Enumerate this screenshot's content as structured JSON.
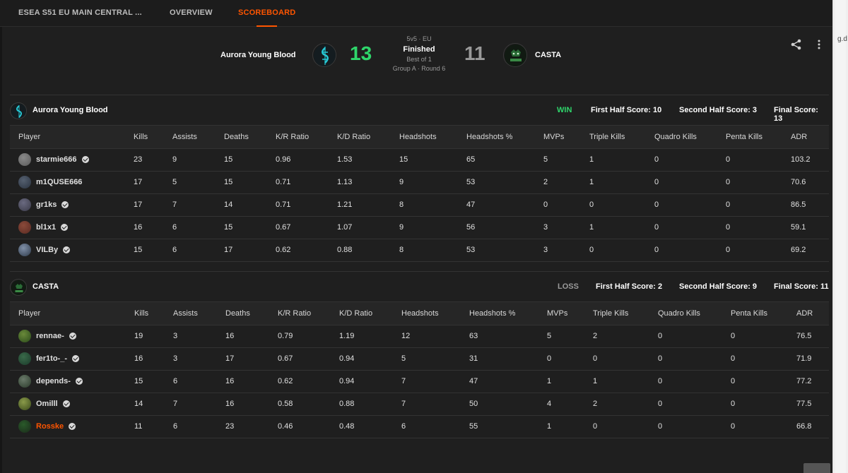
{
  "nav": {
    "tabs": [
      {
        "label": "ESEA S51 EU MAIN CENTRAL ..."
      },
      {
        "label": "OVERVIEW"
      },
      {
        "label": "SCOREBOARD",
        "active": true
      }
    ]
  },
  "edge_text": "g.d",
  "match": {
    "team_a": {
      "name": "Aurora Young Blood",
      "score": "13"
    },
    "team_b": {
      "name": "CASTA",
      "score": "11"
    },
    "format": "5v5 · EU",
    "status": "Finished",
    "best_of": "Best of 1",
    "stage": "Group A · Round 6"
  },
  "colors": {
    "accent": "#ff5500",
    "win": "#2fd66b",
    "loss": "#9a9a9a"
  },
  "icons": {
    "share": "share-icon",
    "more": "more-vertical-icon",
    "verified": "verified-badge-icon"
  },
  "columns": [
    "Player",
    "Kills",
    "Assists",
    "Deaths",
    "K/R Ratio",
    "K/D Ratio",
    "Headshots",
    "Headshots %",
    "MVPs",
    "Triple Kills",
    "Quadro Kills",
    "Penta Kills",
    "ADR"
  ],
  "teams": [
    {
      "name": "Aurora Young Blood",
      "result": "WIN",
      "first_half": "First Half Score: 10",
      "second_half": "Second Half Score: 3",
      "final": "Final Score: 13",
      "players": [
        {
          "name": "starmie666",
          "verified": true,
          "stats": [
            "23",
            "9",
            "15",
            "0.96",
            "1.53",
            "15",
            "65",
            "5",
            "1",
            "0",
            "0",
            "103.2"
          ]
        },
        {
          "name": "m1QUSE666",
          "verified": false,
          "stats": [
            "17",
            "5",
            "15",
            "0.71",
            "1.13",
            "9",
            "53",
            "2",
            "1",
            "0",
            "0",
            "70.6"
          ]
        },
        {
          "name": "gr1ks",
          "verified": true,
          "stats": [
            "17",
            "7",
            "14",
            "0.71",
            "1.21",
            "8",
            "47",
            "0",
            "0",
            "0",
            "0",
            "86.5"
          ]
        },
        {
          "name": "bl1x1",
          "verified": true,
          "stats": [
            "16",
            "6",
            "15",
            "0.67",
            "1.07",
            "9",
            "56",
            "3",
            "1",
            "0",
            "0",
            "59.1"
          ]
        },
        {
          "name": "VILBy",
          "verified": true,
          "stats": [
            "15",
            "6",
            "17",
            "0.62",
            "0.88",
            "8",
            "53",
            "3",
            "0",
            "0",
            "0",
            "69.2"
          ]
        }
      ]
    },
    {
      "name": "CASTA",
      "result": "LOSS",
      "first_half": "First Half Score: 2",
      "second_half": "Second Half Score: 9",
      "final": "Final Score: 11",
      "players": [
        {
          "name": "rennae-",
          "verified": true,
          "stats": [
            "19",
            "3",
            "16",
            "0.79",
            "1.19",
            "12",
            "63",
            "5",
            "2",
            "0",
            "0",
            "76.5"
          ]
        },
        {
          "name": "fer1to-_-",
          "verified": true,
          "stats": [
            "16",
            "3",
            "17",
            "0.67",
            "0.94",
            "5",
            "31",
            "0",
            "0",
            "0",
            "0",
            "71.9"
          ]
        },
        {
          "name": "depends-",
          "verified": true,
          "stats": [
            "15",
            "6",
            "16",
            "0.62",
            "0.94",
            "7",
            "47",
            "1",
            "1",
            "0",
            "0",
            "77.2"
          ]
        },
        {
          "name": "Omilll",
          "verified": true,
          "stats": [
            "14",
            "7",
            "16",
            "0.58",
            "0.88",
            "7",
            "50",
            "4",
            "2",
            "0",
            "0",
            "77.5"
          ]
        },
        {
          "name": "Rosske",
          "verified": true,
          "highlight": true,
          "stats": [
            "11",
            "6",
            "23",
            "0.46",
            "0.48",
            "6",
            "55",
            "1",
            "0",
            "0",
            "0",
            "66.8"
          ]
        }
      ]
    }
  ]
}
